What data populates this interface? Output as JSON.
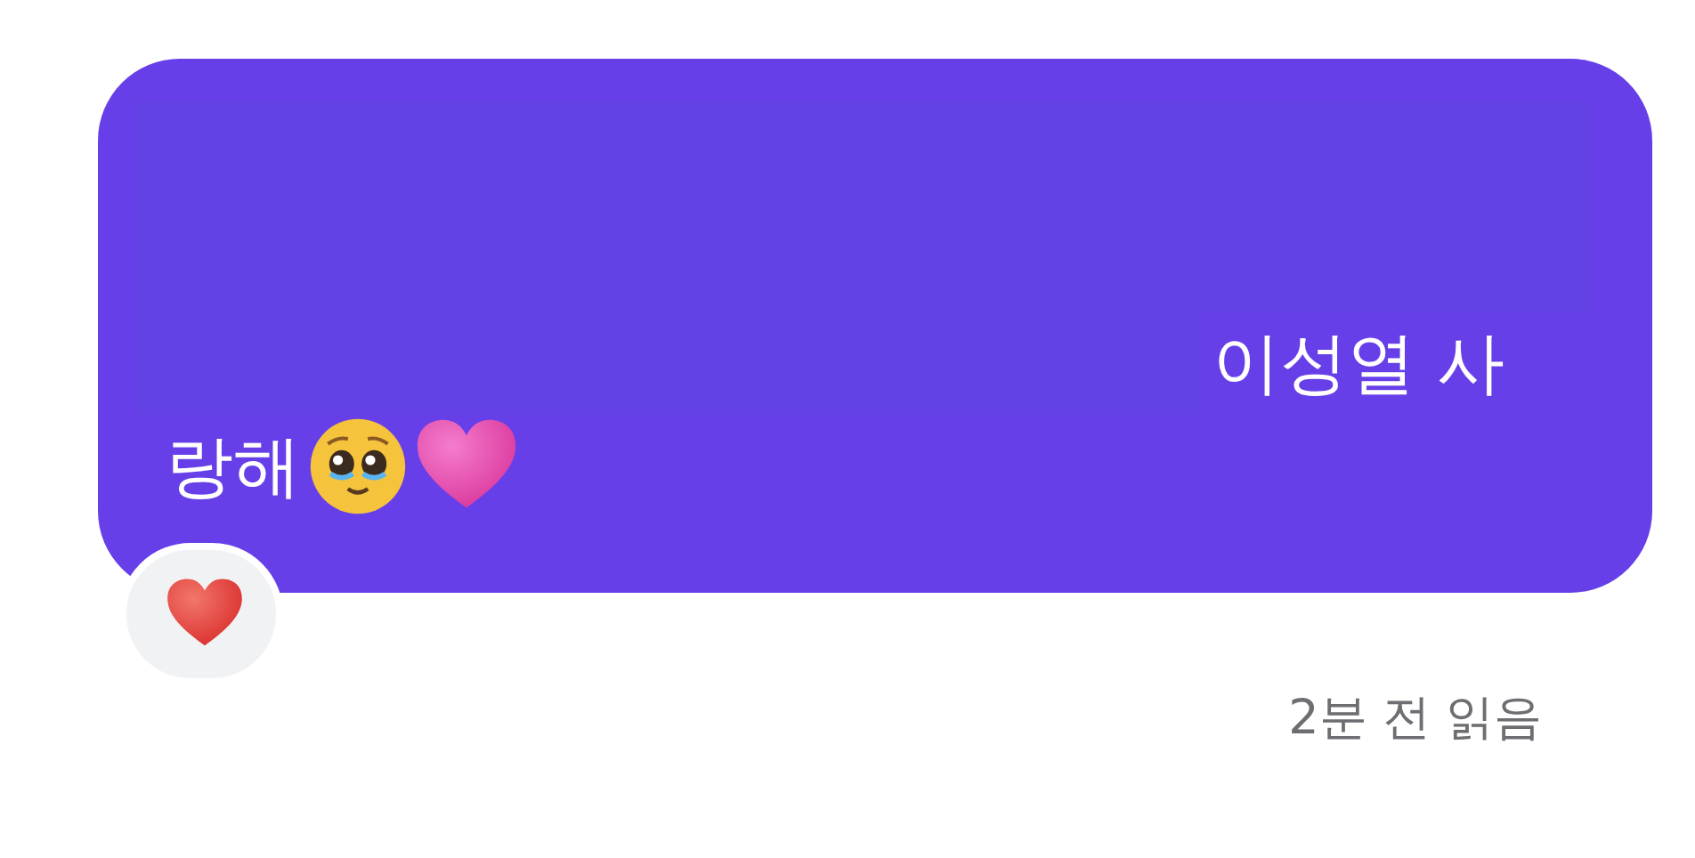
{
  "message": {
    "lines": [
      {
        "segments": [
          {
            "kind": "redacted"
          }
        ]
      },
      {
        "segments": [
          {
            "kind": "redacted"
          },
          {
            "kind": "text",
            "text": "이성열 사"
          }
        ]
      },
      {
        "segments": [
          {
            "kind": "text",
            "text": "랑해"
          },
          {
            "kind": "pleading-face"
          },
          {
            "kind": "pink-heart"
          }
        ]
      }
    ],
    "reaction": {
      "kind": "red-heart"
    }
  },
  "read_receipt": "2분 전 읽음"
}
